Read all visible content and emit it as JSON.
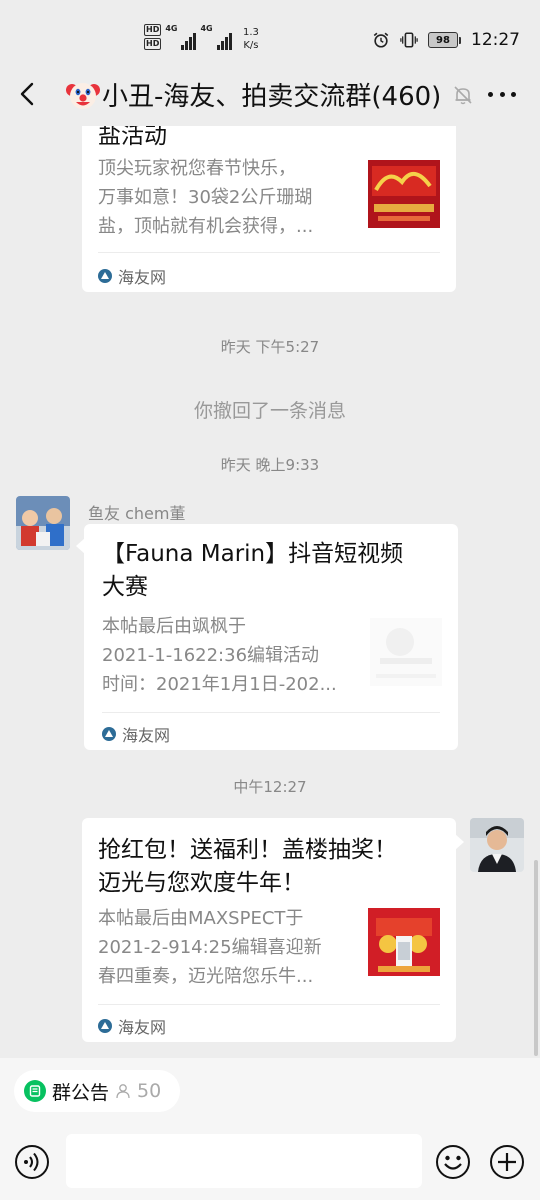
{
  "status": {
    "hd1": "HD",
    "hd2": "HD",
    "net1": "4G",
    "net2": "4G",
    "speed_value": "1.3",
    "speed_unit": "K/s",
    "battery": "98",
    "time": "12:27",
    "icons": [
      "alarm-icon",
      "vibrate-icon",
      "battery-icon"
    ]
  },
  "header": {
    "title": "小丑-海友、拍卖交流群(460)",
    "title_emoji": "clown-face",
    "icons": [
      "back-icon",
      "mute-bell-icon",
      "more-icon"
    ]
  },
  "messages": {
    "card1": {
      "title": "盐活动",
      "desc": [
        "顶尖玩家祝您春节快乐，",
        "万事如意！30袋2公斤珊瑚",
        "盐，顶帖就有机会获得，..."
      ],
      "source": "海友网"
    },
    "ts1": "昨天 下午5:27",
    "recall": "你撤回了一条消息",
    "ts2": "昨天 晚上9:33",
    "msg2": {
      "sender": "鱼友 chem董",
      "title": [
        "【Fauna Marin】抖音短视频",
        "大赛"
      ],
      "desc": [
        "本帖最后由飒枫于",
        "2021-1-1622:36编辑活动",
        "时间：2021年1月1日-202..."
      ],
      "source": "海友网"
    },
    "ts3": "中午12:27",
    "msg3": {
      "title": [
        "抢红包！送福利！盖楼抽奖！",
        "迈光与您欢度牛年！"
      ],
      "desc": [
        "本帖最后由MAXSPECT于",
        "2021-2-914:25编辑喜迎新",
        "春四重奏，迈光陪您乐牛..."
      ],
      "source": "海友网"
    }
  },
  "bottom": {
    "notice_label": "群公告",
    "notice_count": "50",
    "input_placeholder": "",
    "icons": [
      "voice-icon",
      "emoji-icon",
      "plus-icon"
    ]
  },
  "colors": {
    "background": "#ededed",
    "card": "#ffffff",
    "accent_green": "#07c160",
    "source_icon": "#2d6c97"
  }
}
